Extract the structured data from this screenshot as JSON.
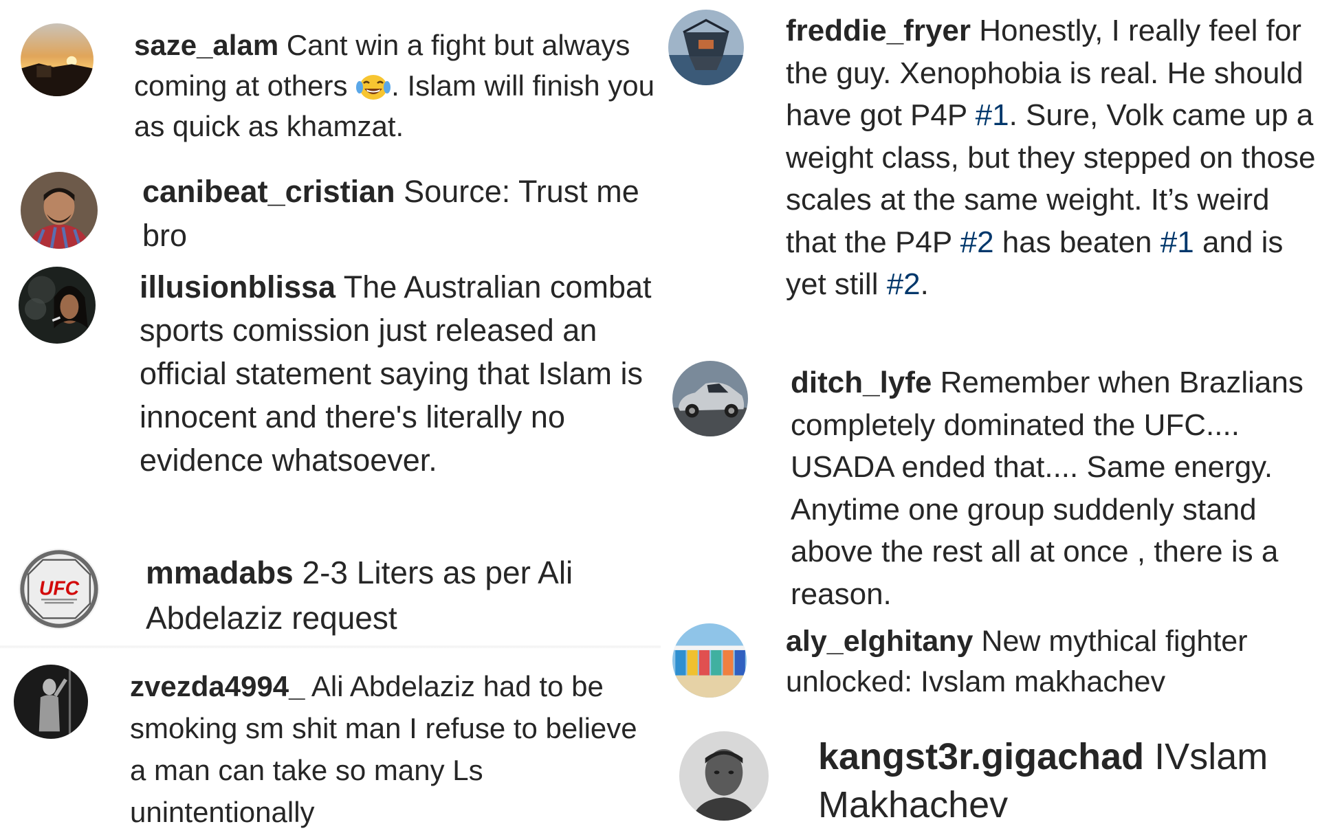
{
  "comments_left": [
    {
      "username": "saze_alam",
      "text_before_emoji": " Cant win a fight but always coming at others ",
      "emoji": "face-with-tears-of-joy",
      "text_after_emoji": ". Islam will finish you as quick as khamzat."
    },
    {
      "username": "canibeat_cristian",
      "text": " Source: Trust me bro"
    },
    {
      "username": "illusionblissa",
      "text": " The Australian combat sports comission just released an official statement saying that Islam is innocent and there's literally no evidence whatsoever."
    },
    {
      "username": "mmadabs",
      "text": " 2-3 Liters as per Ali Abdelaziz request"
    },
    {
      "username": "zvezda4994_",
      "text": " Ali Abdelaziz had to be smoking sm shit man I refuse to believe a man can take so many Ls unintentionally"
    }
  ],
  "comments_right": [
    {
      "username": "freddie_fryer",
      "segments": [
        {
          "t": " Honestly, I really feel for the guy. Xenophobia is real. He should have got P4P ",
          "tag": false
        },
        {
          "t": "#1",
          "tag": true
        },
        {
          "t": ". Sure, Volk came up a weight class, but they stepped on those scales at the same weight. It’s weird that the P4P ",
          "tag": false
        },
        {
          "t": "#2",
          "tag": true
        },
        {
          "t": " has beaten ",
          "tag": false
        },
        {
          "t": "#1",
          "tag": true
        },
        {
          "t": " and is yet still ",
          "tag": false
        },
        {
          "t": "#2",
          "tag": true
        },
        {
          "t": ".",
          "tag": false
        }
      ]
    },
    {
      "username": "ditch_lyfe",
      "text": " Remember when Brazlians completely dominated the UFC.... USADA ended that.... Same energy. Anytime one group suddenly stand above the rest all at once , there is a reason."
    },
    {
      "username": "aly_elghitany",
      "text": " New mythical fighter unlocked: Ivslam makhachev"
    },
    {
      "username": "kangst3r.gigachad",
      "text": " IVslam Makhachev"
    }
  ],
  "avatars": {
    "saze_alam": "sunset-photo",
    "canibeat_cristian": "man-portrait",
    "illusionblissa": "woman-smoke-portrait",
    "mmadabs": "ufc-logo",
    "zvezda4994_": "bw-figure-photo",
    "freddie_fryer": "water-structure-photo",
    "ditch_lyfe": "silver-car-photo",
    "aly_elghitany": "beach-huts-photo",
    "kangst3r.gigachad": "bw-man-portrait"
  },
  "colors": {
    "text": "#262626",
    "hashtag": "#00376b",
    "ufc_red": "#d20a0a"
  }
}
